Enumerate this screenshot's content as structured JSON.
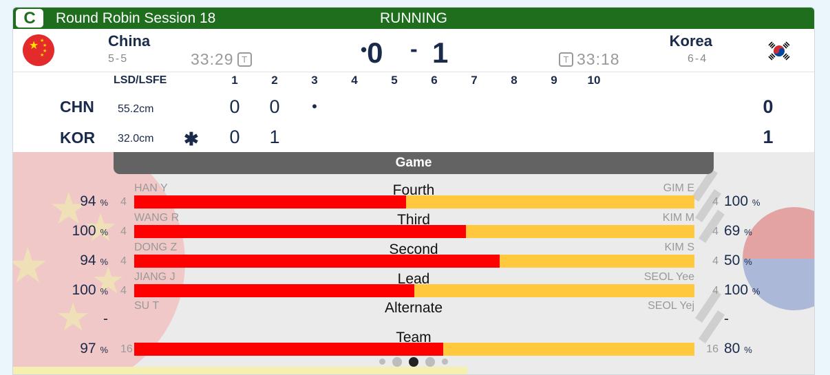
{
  "header": {
    "badge": "C",
    "session": "Round Robin Session 18",
    "status": "RUNNING"
  },
  "teams": {
    "left": {
      "name": "China",
      "record": "5-5",
      "time": "33:29",
      "score": "0",
      "code": "CHN",
      "distance": "55.2cm",
      "total": "0",
      "flag": "china-flag"
    },
    "right": {
      "name": "Korea",
      "record": "6-4",
      "time": "33:18",
      "score": "1",
      "code": "KOR",
      "distance": "32.0cm",
      "total": "1",
      "flag": "korea-flag"
    }
  },
  "timeout_badge": "T",
  "score_sep": "-",
  "linescore": {
    "header_label": "LSD/LSFE",
    "ends": [
      "1",
      "2",
      "3",
      "4",
      "5",
      "6",
      "7",
      "8",
      "9",
      "10"
    ],
    "chn": [
      "0",
      "0"
    ],
    "kor": [
      "0",
      "1"
    ],
    "current_end_marker": "•",
    "hammer_symbol": "✱"
  },
  "game": {
    "title": "Game",
    "positions": [
      {
        "title": "Fourth",
        "left_player": "HAN Y",
        "right_player": "GIM E",
        "left_pct": "94",
        "right_pct": "100",
        "left_n": "4",
        "right_n": "4",
        "left_share": 0.485
      },
      {
        "title": "Third",
        "left_player": "WANG R",
        "right_player": "KIM M",
        "left_pct": "100",
        "right_pct": "69",
        "left_n": "4",
        "right_n": "4",
        "left_share": 0.592
      },
      {
        "title": "Second",
        "left_player": "DONG Z",
        "right_player": "KIM S",
        "left_pct": "94",
        "right_pct": "50",
        "left_n": "4",
        "right_n": "4",
        "left_share": 0.652
      },
      {
        "title": "Lead",
        "left_player": "JIANG J",
        "right_player": "SEOL Yee",
        "left_pct": "100",
        "right_pct": "100",
        "left_n": "4",
        "right_n": "4",
        "left_share": 0.5
      },
      {
        "title": "Alternate",
        "left_player": "SU T",
        "right_player": "SEOL Yej",
        "left_pct": "-",
        "right_pct": "-",
        "left_n": "",
        "right_n": "",
        "left_share": null
      },
      {
        "title": "Team",
        "left_player": "",
        "right_player": "",
        "left_pct": "97",
        "right_pct": "80",
        "left_n": "16",
        "right_n": "16",
        "left_share": 0.551
      }
    ],
    "percent_sign": "%"
  },
  "colors": {
    "header_green": "#1e6e1e",
    "china_red": "#ff0000",
    "korea_yellow": "#ffc83d",
    "navy": "#1a2a4a"
  },
  "pager": {
    "count": 5,
    "active": 2
  }
}
